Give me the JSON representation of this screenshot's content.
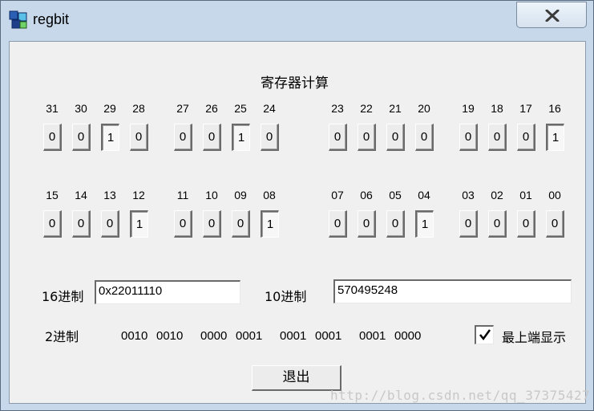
{
  "window": {
    "title": "regbit",
    "close_icon": "close-icon",
    "app_icon": "cubes-icon"
  },
  "heading": "寄存器计算",
  "bits_upper": [
    {
      "label": "31",
      "value": "0"
    },
    {
      "label": "30",
      "value": "0"
    },
    {
      "label": "29",
      "value": "1"
    },
    {
      "label": "28",
      "value": "0"
    },
    {
      "label": "27",
      "value": "0"
    },
    {
      "label": "26",
      "value": "0"
    },
    {
      "label": "25",
      "value": "1"
    },
    {
      "label": "24",
      "value": "0"
    },
    {
      "label": "23",
      "value": "0"
    },
    {
      "label": "22",
      "value": "0"
    },
    {
      "label": "21",
      "value": "0"
    },
    {
      "label": "20",
      "value": "0"
    },
    {
      "label": "19",
      "value": "0"
    },
    {
      "label": "18",
      "value": "0"
    },
    {
      "label": "17",
      "value": "0"
    },
    {
      "label": "16",
      "value": "1"
    }
  ],
  "bits_lower": [
    {
      "label": "15",
      "value": "0"
    },
    {
      "label": "14",
      "value": "0"
    },
    {
      "label": "13",
      "value": "0"
    },
    {
      "label": "12",
      "value": "1"
    },
    {
      "label": "11",
      "value": "0"
    },
    {
      "label": "10",
      "value": "0"
    },
    {
      "label": "09",
      "value": "0"
    },
    {
      "label": "08",
      "value": "1"
    },
    {
      "label": "07",
      "value": "0"
    },
    {
      "label": "06",
      "value": "0"
    },
    {
      "label": "05",
      "value": "0"
    },
    {
      "label": "04",
      "value": "1"
    },
    {
      "label": "03",
      "value": "0"
    },
    {
      "label": "02",
      "value": "0"
    },
    {
      "label": "01",
      "value": "0"
    },
    {
      "label": "00",
      "value": "0"
    }
  ],
  "hex": {
    "label": "16进制",
    "value": "0x22011110"
  },
  "dec": {
    "label": "10进制",
    "value": "570495248"
  },
  "bin": {
    "label": "2进制",
    "groups": [
      "0010",
      "0010",
      "0000",
      "0001",
      "0001",
      "0001",
      "0001",
      "0000"
    ]
  },
  "topmost": {
    "label": "最上端显示",
    "checked": true
  },
  "exit_label": "退出",
  "watermark": "http://blog.csdn.net/qq_37375427"
}
